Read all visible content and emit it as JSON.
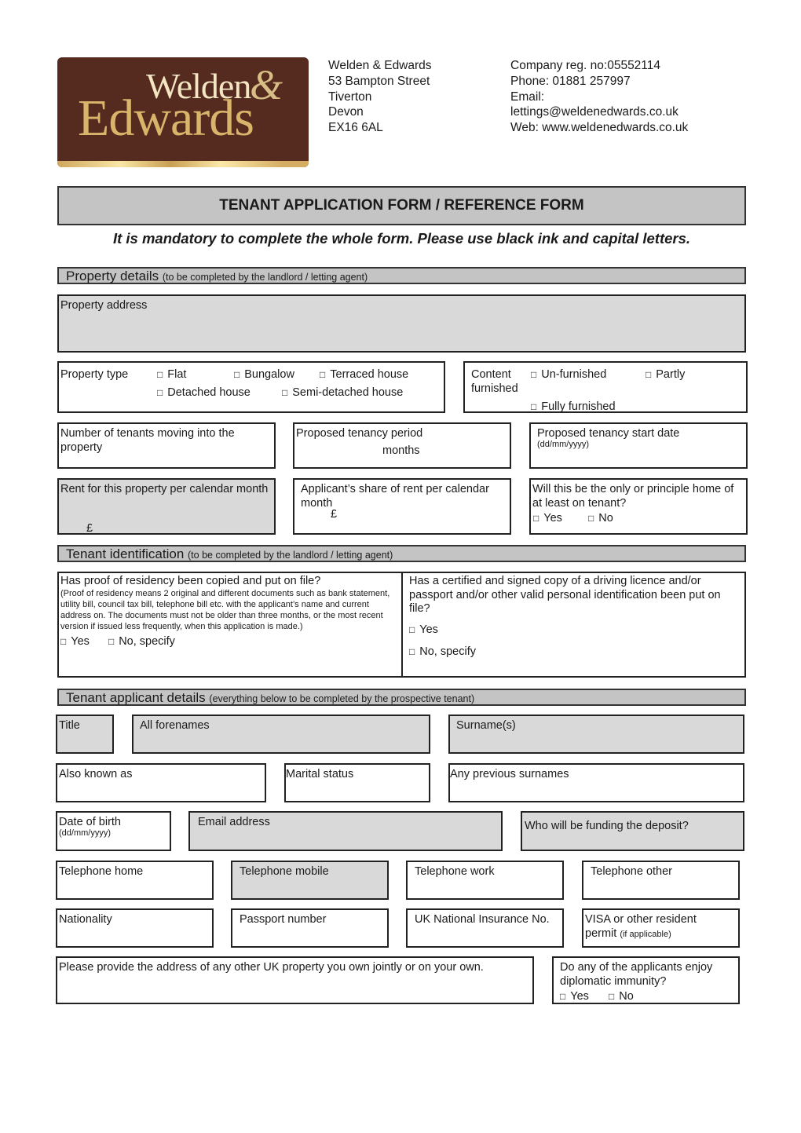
{
  "logo": {
    "line1": "Welden",
    "amp": "&",
    "line2": "Edwards"
  },
  "company": {
    "address_lines": [
      "Welden & Edwards",
      "53 Bampton Street",
      "Tiverton",
      "Devon",
      "EX16 6AL"
    ],
    "contact_lines": [
      "Company reg. no:05552114",
      "Phone: 01881 257997",
      "Email:",
      "lettings@weldenedwards.co.uk",
      "Web: www.weldenedwards.co.uk"
    ]
  },
  "form_title": "TENANT APPLICATION FORM / REFERENCE FORM",
  "instruction": "It is mandatory to complete the whole form. Please use black ink and capital letters.",
  "property_details": {
    "heading": "Property details",
    "heading_note": "(to be completed by the landlord / letting agent)",
    "property_address_label": "Property address",
    "property_type": {
      "label": "Property type",
      "options": [
        "Flat",
        "Bungalow",
        "Terraced house",
        "Detached house",
        "Semi-detached house"
      ]
    },
    "content": {
      "label_line1": "Content",
      "label_line2": "furnished",
      "options": [
        "Un-furnished",
        "Partly",
        "Fully furnished"
      ]
    },
    "num_tenants_label": "Number of tenants moving into the property",
    "tenancy_period_label": "Proposed tenancy period",
    "tenancy_period_unit": "months",
    "start_date_label": "Proposed tenancy start date",
    "start_date_hint": "(dd/mm/yyyy)",
    "rent_label": "Rent for this property per calendar month",
    "rent_currency": "£",
    "share_label": "Applicant’s share of rent per calendar month",
    "share_currency": "£",
    "principal_home_label": "Will this be the only or principle home of at least on tenant?",
    "yes": "Yes",
    "no": "No"
  },
  "tenant_identification": {
    "heading": "Tenant identification",
    "heading_note": "(to be completed by the landlord / letting agent)",
    "residency_question": "Has proof of residency been copied and put on file?",
    "residency_note": "(Proof of residency means 2 original and different documents such as bank statement, utility bill, council tax bill, telephone bill etc. with the applicant’s name and current address on. The documents must not be older than three months, or the most recent version if issued less frequently, when this application is made.)",
    "id_question": "Has a certified and signed copy of a driving licence and/or passport and/or other valid personal identification been put on file?",
    "yes": "Yes",
    "no_specify": "No, specify"
  },
  "applicant_details": {
    "heading": "Tenant applicant details",
    "heading_note": "(everything below to be completed by the prospective tenant)",
    "title": "Title",
    "forenames": "All forenames",
    "surnames": "Surname(s)",
    "aka": "Also known as",
    "marital": "Marital status",
    "prev_surnames": "Any previous surnames",
    "dob": "Date of birth",
    "dob_hint": "(dd/mm/yyyy)",
    "email": "Email address",
    "deposit": "Who will be funding the deposit?",
    "tel_home": "Telephone home",
    "tel_mobile": "Telephone mobile",
    "tel_work": "Telephone work",
    "tel_other": "Telephone other",
    "nationality": "Nationality",
    "passport": "Passport number",
    "ni": "UK National Insurance No.",
    "visa": "VISA or other resident permit",
    "visa_hint": "(if applicable)",
    "other_property": "Please provide the address of any other UK property you own jointly or on your own.",
    "diplomatic": "Do any of the applicants enjoy diplomatic immunity?",
    "yes": "Yes",
    "no": "No"
  },
  "checkbox_glyph": "□"
}
